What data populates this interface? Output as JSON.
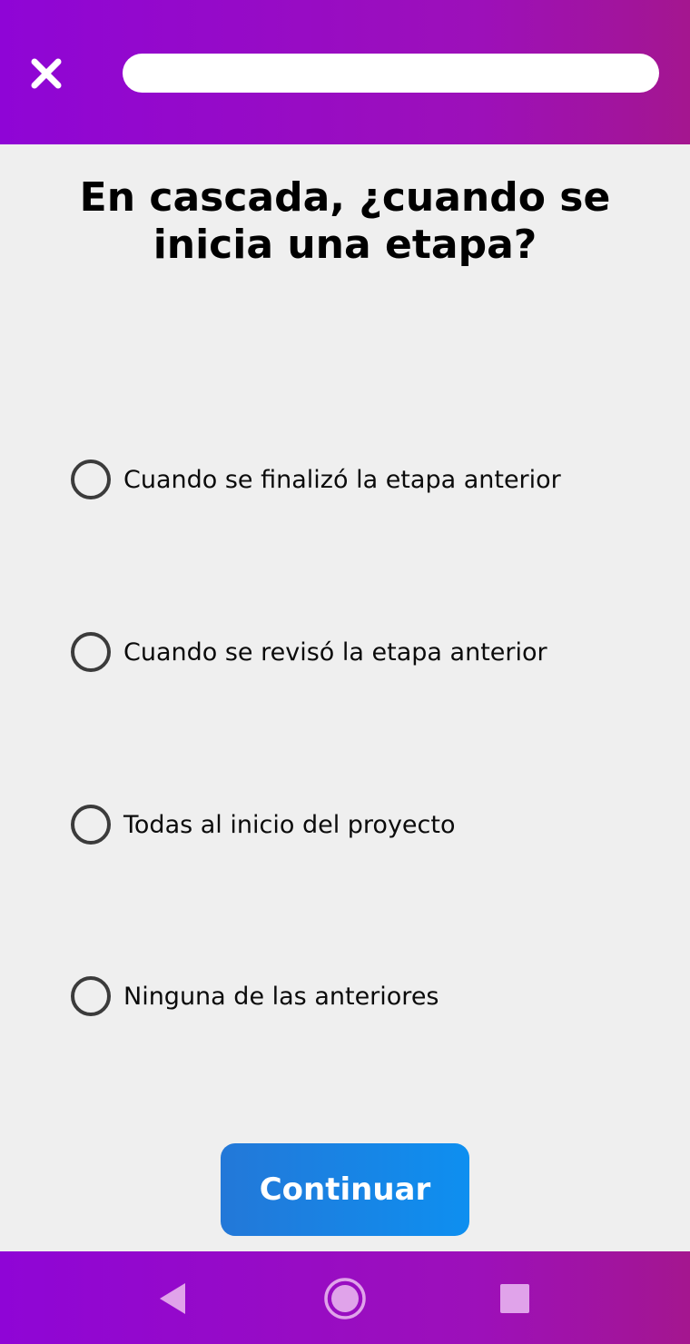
{
  "header": {
    "close_icon": "close-icon",
    "progress": 0,
    "colors": {
      "gradient_start": "#8f05d6",
      "gradient_end": "#a4168f",
      "track": "#ffffff"
    }
  },
  "question": {
    "text": "En cascada, ¿cuando se inicia una etapa?"
  },
  "options": [
    {
      "label": "Cuando se finalizó la etapa anterior",
      "selected": false
    },
    {
      "label": "Cuando se revisó la etapa anterior",
      "selected": false
    },
    {
      "label": "Todas al inicio del proyecto",
      "selected": false
    },
    {
      "label": "Ninguna de las anteriores",
      "selected": false
    }
  ],
  "continue_button": {
    "label": "Continuar",
    "color": "#1a84e4"
  },
  "nav_bar": {
    "back_icon": "back-triangle-icon",
    "home_icon": "home-circle-icon",
    "recents_icon": "recents-square-icon"
  }
}
